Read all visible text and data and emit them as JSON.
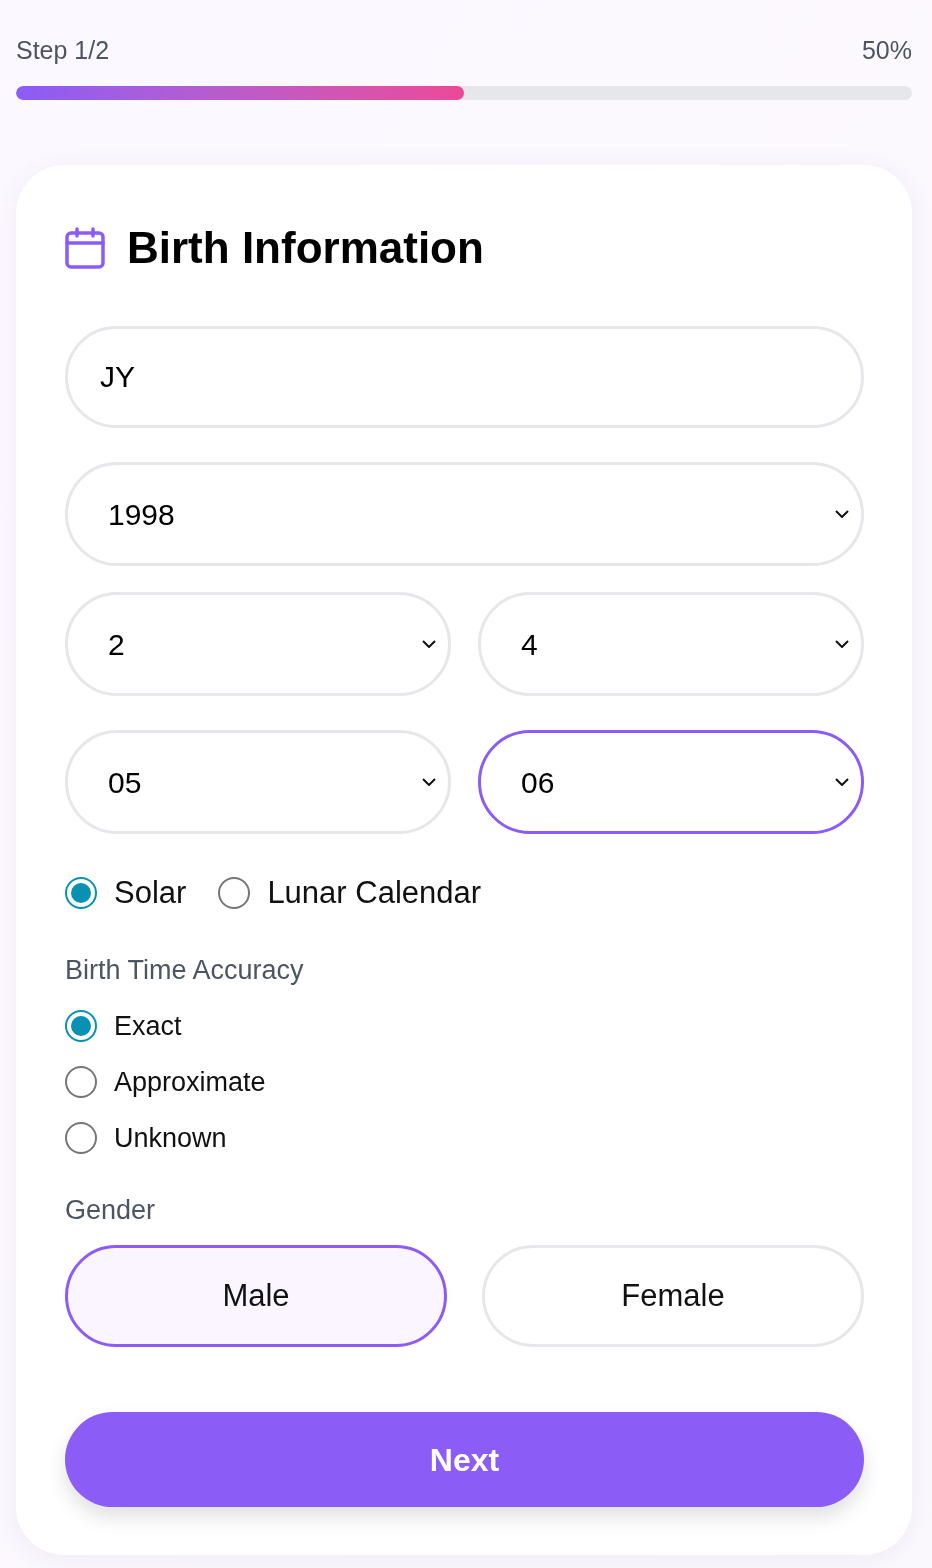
{
  "progress": {
    "step_label": "Step 1/2",
    "percent": "50%",
    "level": 0.5
  },
  "card": {
    "title": "Birth Information",
    "name_field": {
      "value": "JY"
    },
    "select_rows": [
      {
        "selects": [
          {
            "value": "1998",
            "focused": false
          }
        ]
      },
      {
        "selects": [
          {
            "value": "2",
            "focused": false
          },
          {
            "value": "4",
            "focused": false
          }
        ]
      },
      {
        "selects": [
          {
            "value": "05",
            "focused": false
          },
          {
            "value": "06",
            "focused": true
          }
        ]
      }
    ],
    "calendar_options": [
      {
        "label": "Solar",
        "selected": true
      },
      {
        "label": "Lunar Calendar",
        "selected": false
      }
    ],
    "accuracy": {
      "label": "Birth Time Accuracy",
      "options": [
        {
          "label": "Exact",
          "selected": true
        },
        {
          "label": "Approximate",
          "selected": false
        },
        {
          "label": "Unknown",
          "selected": false
        }
      ]
    },
    "gender": {
      "label": "Gender",
      "options": [
        {
          "label": "Male",
          "selected": true
        },
        {
          "label": "Female",
          "selected": false
        }
      ]
    },
    "next_button": {
      "label": "Next"
    }
  }
}
